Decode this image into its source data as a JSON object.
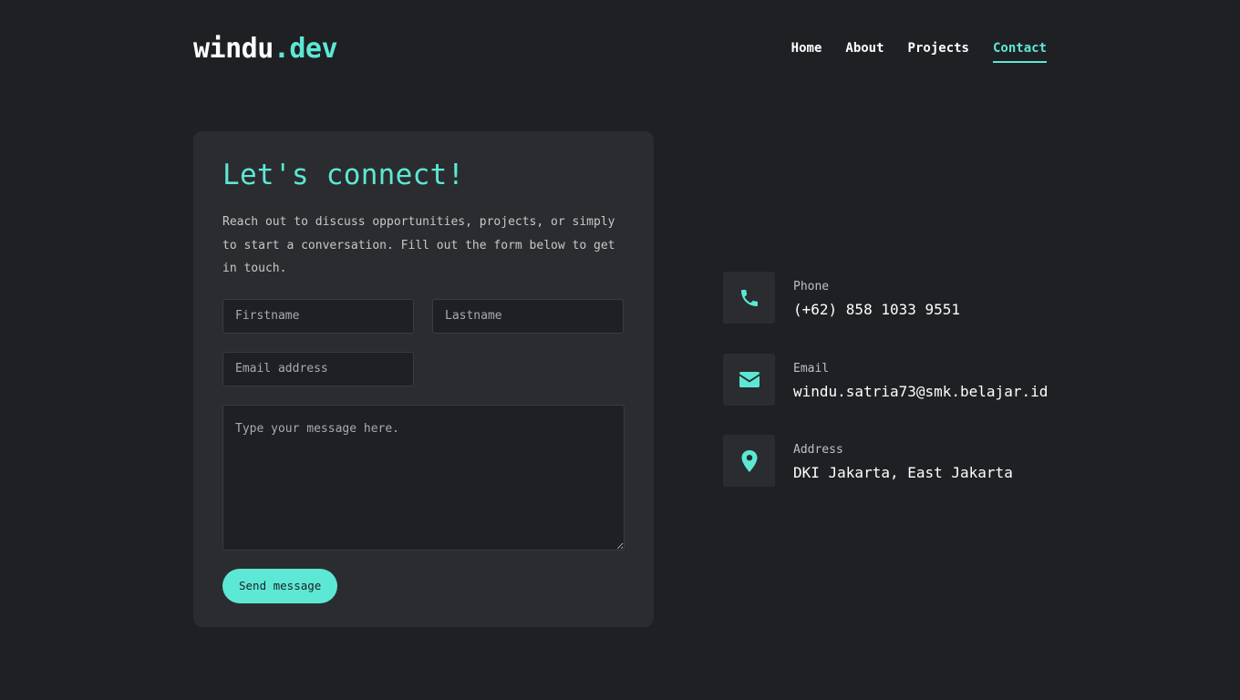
{
  "brand": {
    "name": "windu",
    "tld": ".dev"
  },
  "nav": {
    "items": [
      {
        "label": "Home"
      },
      {
        "label": "About"
      },
      {
        "label": "Projects"
      },
      {
        "label": "Contact",
        "active": true
      }
    ]
  },
  "form": {
    "heading": "Let's connect!",
    "intro": "Reach out to discuss opportunities, projects, or simply to start a conversation. Fill out the form below to get in touch.",
    "firstname_placeholder": "Firstname",
    "lastname_placeholder": "Lastname",
    "email_placeholder": "Email address",
    "message_placeholder": "Type your message here.",
    "submit_label": "Send message"
  },
  "contact": {
    "phone": {
      "label": "Phone",
      "value": "(+62) 858 1033 9551",
      "icon": "phone-icon"
    },
    "email": {
      "label": "Email",
      "value": "windu.satria73@smk.belajar.id",
      "icon": "envelope-icon"
    },
    "address": {
      "label": "Address",
      "value": "DKI Jakarta, East Jakarta",
      "icon": "map-pin-icon"
    }
  },
  "colors": {
    "accent": "#5ce8d4",
    "background": "#1f2024",
    "card": "#2b2c30"
  }
}
